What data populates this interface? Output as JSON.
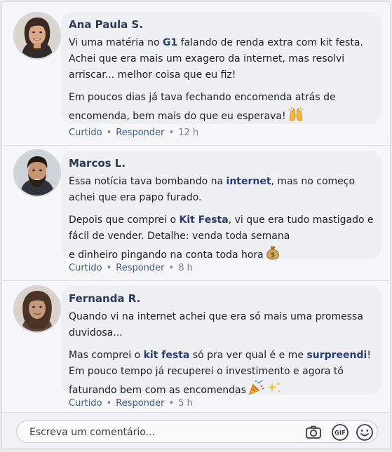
{
  "comments": [
    {
      "author": "Ana Paula S.",
      "paragraphs": [
        [
          {
            "t": "Vi uma matéria no "
          },
          {
            "t": "G1",
            "b": true
          },
          {
            "t": " falando de renda extra com kit festa. Achei que era mais um exagero da internet, mas resolvi arriscar... melhor coisa que eu fiz!"
          }
        ],
        [
          {
            "t": "Em poucos dias já tava fechando encomenda atrás de encomenda, bem mais do que eu esperava!"
          },
          {
            "e": "raised-hands"
          }
        ]
      ],
      "actions": {
        "like": "Curtido",
        "reply": "Responder",
        "time": "12 h"
      }
    },
    {
      "author": "Marcos L.",
      "paragraphs": [
        [
          {
            "t": "Essa notícia tava bombando na "
          },
          {
            "t": "internet",
            "b": true
          },
          {
            "t": ", mas no começo achei que era papo furado."
          }
        ],
        [
          {
            "t": "Depois que comprei o "
          },
          {
            "t": "Kit Festa",
            "b": true
          },
          {
            "t": ", vi que era tudo mastigado e fácil de vender. Detalhe: venda toda semana "
          },
          {
            "br": true
          },
          {
            "t": "e dinheiro pingando na conta toda hora"
          },
          {
            "e": "money-bag"
          }
        ]
      ],
      "actions": {
        "like": "Curtido",
        "reply": "Responder",
        "time": "8 h"
      }
    },
    {
      "author": "Fernanda R.",
      "paragraphs": [
        [
          {
            "t": "Quando vi na internet achei que era só mais uma promessa duvidosa..."
          }
        ],
        [
          {
            "t": "Mas comprei o "
          },
          {
            "t": "kit festa",
            "b": true
          },
          {
            "t": " só pra ver qual é e me "
          },
          {
            "t": "surpreendi",
            "b": true
          },
          {
            "t": "! Em pouco tempo já recuperei o investimento e agora tó faturando bem com as encomendas"
          },
          {
            "e": "party-popper"
          },
          {
            "e": "sparkles"
          }
        ]
      ],
      "actions": {
        "like": "Curtido",
        "reply": "Responder",
        "time": "5 h"
      }
    }
  ],
  "composer": {
    "placeholder": "Escreva um comentário...",
    "icons": [
      "camera-icon",
      "gif-icon",
      "smiley-icon"
    ]
  },
  "colors": {
    "author": "#2b3a55",
    "highlight": "#2b3a78",
    "action": "#3f5a8a",
    "bubble": "#eef0f3"
  }
}
